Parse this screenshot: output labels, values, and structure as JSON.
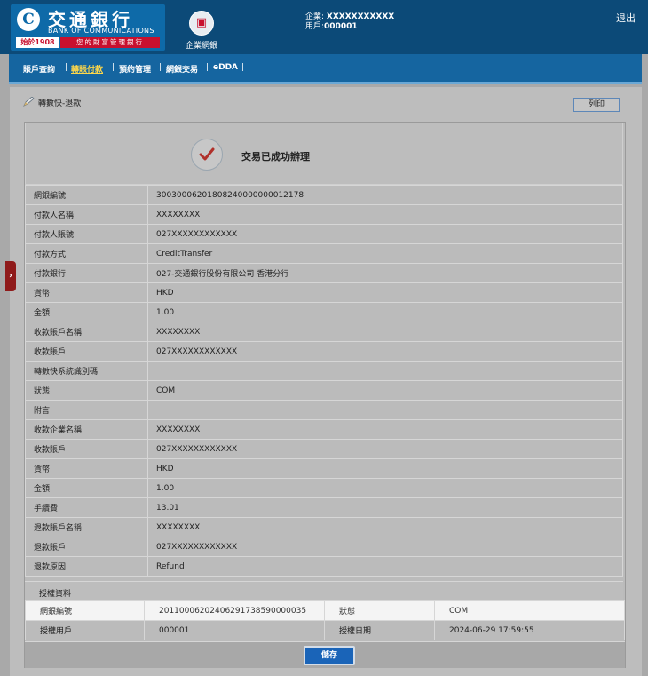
{
  "header": {
    "logo_cn": "交通銀行",
    "logo_en": "BANK OF COMMUNICATIONS",
    "logo_since": "始於1908",
    "logo_slogan": "您的財富管理銀行",
    "ebank_label": "企業網銀",
    "company_label": "企業:",
    "company_value": "XXXXXXXXXXX",
    "user_label": "用戶:",
    "user_value": "000001",
    "logout": "退出"
  },
  "nav": {
    "items": [
      {
        "label": "賬戶查詢",
        "active": false
      },
      {
        "label": "轉賬付款",
        "active": true
      },
      {
        "label": "預約管理",
        "active": false
      },
      {
        "label": "網銀交易",
        "active": false
      },
      {
        "label": "eDDA",
        "active": false
      }
    ]
  },
  "page": {
    "title": "轉數快-退款",
    "print_label": "列印",
    "success_message": "交易已成功辦理",
    "save_label": "儲存"
  },
  "details": [
    {
      "label": "網銀編號",
      "value": "30030006201808240000000012178"
    },
    {
      "label": "付款人名稱",
      "value": "XXXXXXXX"
    },
    {
      "label": "付款人賬號",
      "value": "027XXXXXXXXXXXX"
    },
    {
      "label": "付款方式",
      "value": "CreditTransfer"
    },
    {
      "label": "付款銀行",
      "value": "027-交通銀行股份有限公司 香港分行"
    },
    {
      "label": "貨幣",
      "value": "HKD"
    },
    {
      "label": "金額",
      "value": "1.00"
    },
    {
      "label": "收款賬戶名稱",
      "value": "XXXXXXXX"
    },
    {
      "label": "收款賬戶",
      "value": "027XXXXXXXXXXXX"
    },
    {
      "label": "轉數快系統識別碼",
      "value": ""
    },
    {
      "label": "狀態",
      "value": "COM"
    },
    {
      "label": "附言",
      "value": ""
    },
    {
      "label": "收款企業名稱",
      "value": "XXXXXXXX"
    },
    {
      "label": "收款賬戶",
      "value": "027XXXXXXXXXXXX"
    },
    {
      "label": "貨幣",
      "value": "HKD"
    },
    {
      "label": "金額",
      "value": "1.00"
    },
    {
      "label": "手續費",
      "value": "13.01"
    },
    {
      "label": "退款賬戶名稱",
      "value": "XXXXXXXX"
    },
    {
      "label": "退款賬戶",
      "value": "027XXXXXXXXXXXX"
    },
    {
      "label": "退款原因",
      "value": "Refund"
    }
  ],
  "auth": {
    "title": "授權資料",
    "rows": [
      [
        "網銀編號",
        "20110006202406291738590000035",
        "狀態",
        "COM"
      ],
      [
        "授權用戶",
        "000001",
        "授權日期",
        "2024-06-29 17:59:55"
      ]
    ]
  },
  "colors": {
    "header_bg": "#0c4a78",
    "nav_bg": "#1565a0",
    "nav_active": "#ffd84a",
    "save_button": "#1a64b8",
    "brand_red": "#c8102e"
  }
}
